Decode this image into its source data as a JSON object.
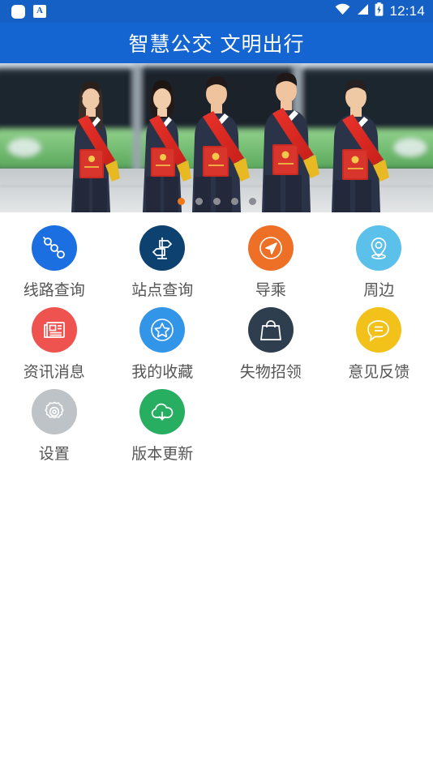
{
  "status_bar": {
    "left_icons": [
      "rounded-square-icon",
      "ime-a-icon"
    ],
    "ime_letter": "A",
    "right_icons": [
      "wifi-icon",
      "signal-icon",
      "battery-charging-icon"
    ],
    "time": "12:14"
  },
  "header": {
    "title": "智慧公交 文明出行",
    "background_color": "#1464d2"
  },
  "banner": {
    "alt": "五位身穿深蓝制服、佩戴红色绶带的公交员工手持红色荣誉证书站在绿色公交车前",
    "dots": {
      "count": 5,
      "active_index": 0,
      "active_color": "#f07818",
      "inactive_color": "#8c8c94"
    }
  },
  "grid": {
    "items": [
      {
        "label": "线路查询",
        "icon": "route-nodes-icon",
        "color": "#1b6fe0"
      },
      {
        "label": "站点查询",
        "icon": "signpost-icon",
        "color": "#0d416f"
      },
      {
        "label": "导乘",
        "icon": "navigation-arrow-icon",
        "color": "#ed7026"
      },
      {
        "label": "周边",
        "icon": "map-pin-icon",
        "color": "#5bc0ea"
      },
      {
        "label": "资讯消息",
        "icon": "newspaper-icon",
        "color": "#ef5350"
      },
      {
        "label": "我的收藏",
        "icon": "star-circle-icon",
        "color": "#3395e8"
      },
      {
        "label": "失物招领",
        "icon": "handbag-icon",
        "color": "#2f3e4f"
      },
      {
        "label": "意见反馈",
        "icon": "speech-bubble-icon",
        "color": "#f2c21a"
      },
      {
        "label": "设置",
        "icon": "gear-icon",
        "color": "#bdc3c7"
      },
      {
        "label": "版本更新",
        "icon": "cloud-download-icon",
        "color": "#27ae60"
      }
    ]
  }
}
